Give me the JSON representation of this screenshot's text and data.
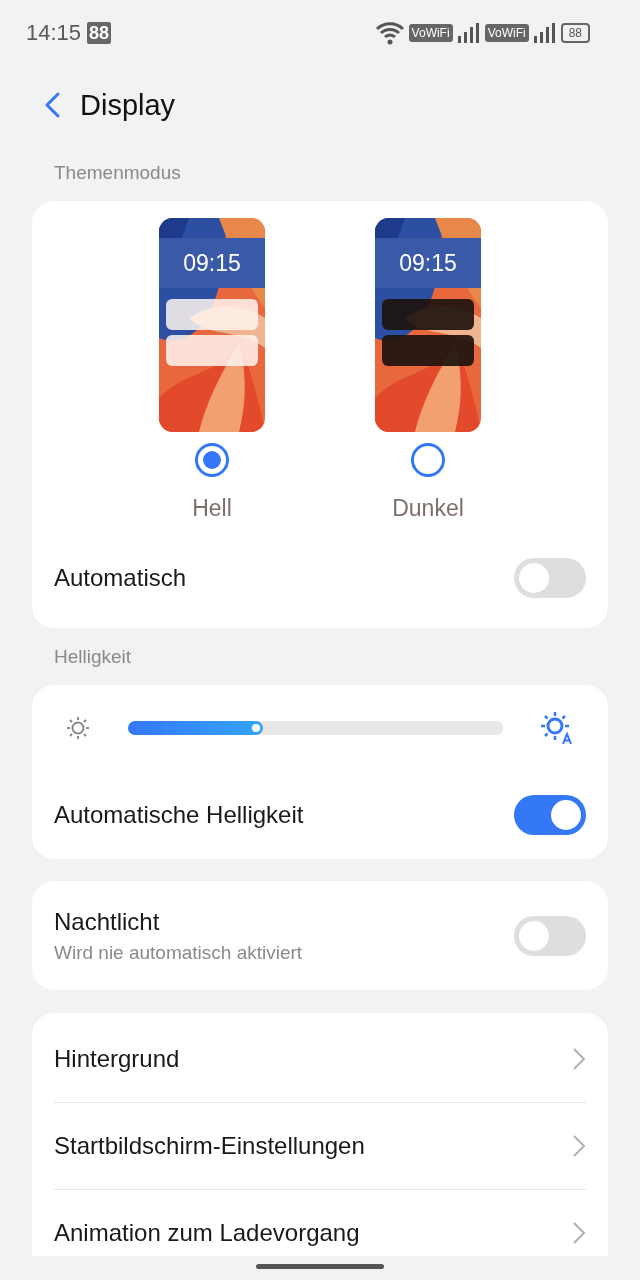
{
  "status_bar": {
    "time": "14:15",
    "notification_badge": "88",
    "sim_labels": [
      "VoWiFi",
      "VoWiFi"
    ],
    "battery": "88"
  },
  "header": {
    "title": "Display"
  },
  "theme_section": {
    "label": "Themenmodus",
    "themes": [
      {
        "kind": "light",
        "clock": "09:15",
        "label": "Hell",
        "selected": true
      },
      {
        "kind": "dark",
        "clock": "09:15",
        "label": "Dunkel",
        "selected": false
      }
    ],
    "auto_row": {
      "label": "Automatisch",
      "on": false
    }
  },
  "brightness_section": {
    "label": "Helligkeit",
    "level": 0.36,
    "auto_row": {
      "label": "Automatische Helligkeit",
      "on": true
    }
  },
  "night_light": {
    "label": "Nachtlicht",
    "subtitle": "Wird nie automatisch aktiviert",
    "on": false
  },
  "links": [
    {
      "label": "Hintergrund"
    },
    {
      "label": "Startbildschirm-Einstellungen"
    },
    {
      "label": "Animation zum Ladevorgang"
    }
  ]
}
